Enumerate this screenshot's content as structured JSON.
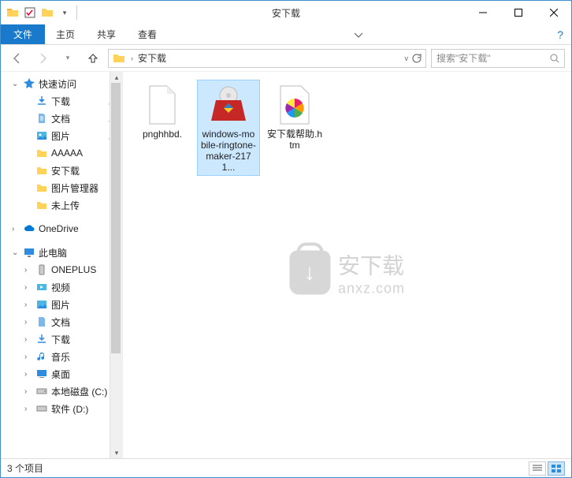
{
  "title": "安下载",
  "ribbon": {
    "file": "文件",
    "tabs": [
      "主页",
      "共享",
      "查看"
    ]
  },
  "address": {
    "crumb": "安下载",
    "search_placeholder": "搜索\"安下载\""
  },
  "sidebar": {
    "quick_access": "快速访问",
    "items_qa": [
      {
        "label": "下载",
        "icon": "download",
        "pinned": true
      },
      {
        "label": "文档",
        "icon": "document",
        "pinned": true
      },
      {
        "label": "图片",
        "icon": "pictures",
        "pinned": true
      },
      {
        "label": "AAAAA",
        "icon": "folder",
        "pinned": false
      },
      {
        "label": "安下载",
        "icon": "folder",
        "pinned": false
      },
      {
        "label": "图片管理器",
        "icon": "folder",
        "pinned": false
      },
      {
        "label": "未上传",
        "icon": "folder",
        "pinned": false
      }
    ],
    "onedrive": "OneDrive",
    "this_pc": "此电脑",
    "items_pc": [
      {
        "label": "ONEPLUS",
        "icon": "device"
      },
      {
        "label": "视频",
        "icon": "video"
      },
      {
        "label": "图片",
        "icon": "pictures"
      },
      {
        "label": "文档",
        "icon": "document"
      },
      {
        "label": "下载",
        "icon": "download"
      },
      {
        "label": "音乐",
        "icon": "music"
      },
      {
        "label": "桌面",
        "icon": "desktop"
      },
      {
        "label": "本地磁盘 (C:)",
        "icon": "disk"
      },
      {
        "label": "软件 (D:)",
        "icon": "disk"
      }
    ]
  },
  "files": [
    {
      "label": "pnghhbd.",
      "icon": "blank",
      "selected": false
    },
    {
      "label": "windows-mobile-ringtone-maker-2171...",
      "icon": "installer",
      "selected": true
    },
    {
      "label": "安下载帮助.htm",
      "icon": "colorwheel",
      "selected": false
    }
  ],
  "watermark": {
    "cn": "安下载",
    "en": "anxz.com"
  },
  "status": {
    "text": "3 个项目"
  }
}
